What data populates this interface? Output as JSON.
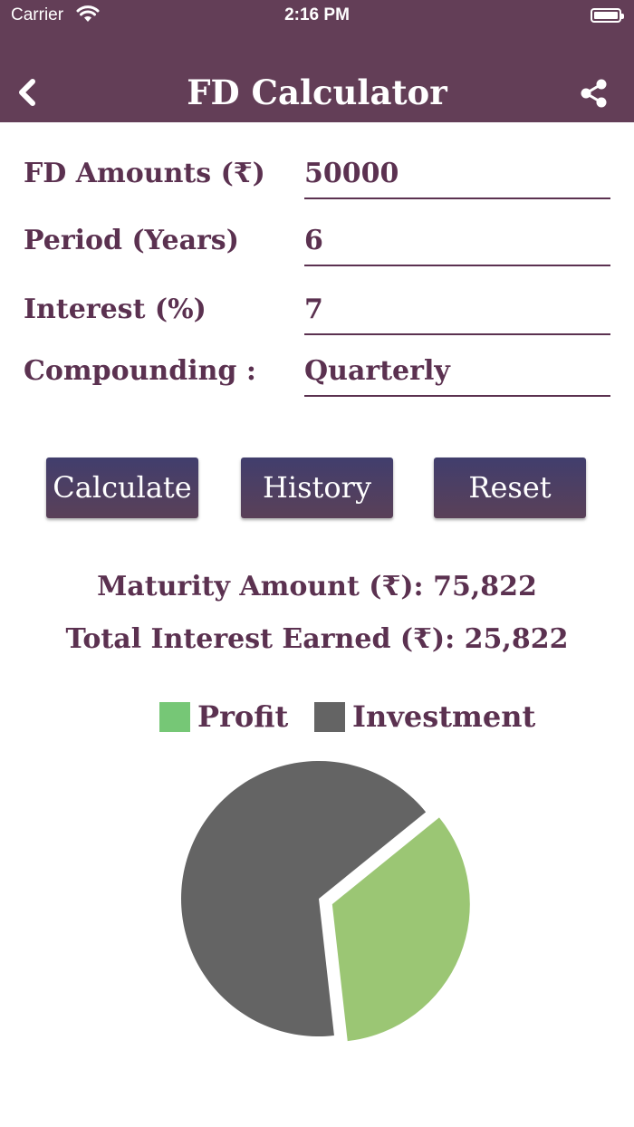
{
  "status_bar": {
    "carrier": "Carrier",
    "time": "2:16 PM"
  },
  "nav": {
    "title": "FD Calculator",
    "back_icon": "chevron-left-icon",
    "share_icon": "share-icon"
  },
  "form": {
    "fields": [
      {
        "label": "FD Amounts (₹)",
        "value": "50000"
      },
      {
        "label": "Period (Years)",
        "value": "6"
      },
      {
        "label": "Interest (%)",
        "value": "7"
      },
      {
        "label": "Compounding :",
        "value": "Quarterly"
      }
    ]
  },
  "buttons": {
    "calculate": "Calculate",
    "history": "History",
    "reset": "Reset"
  },
  "results": {
    "maturity": "Maturity Amount (₹): 75,822",
    "interest": "Total Interest Earned (₹): 25,822"
  },
  "colors": {
    "header": "#633e57",
    "text": "#5b3150",
    "profit_legend": "#76c776",
    "profit_slice": "#9bc674",
    "investment": "#646464"
  },
  "chart_data": {
    "type": "pie",
    "series": [
      {
        "name": "Profit",
        "value": 25822
      },
      {
        "name": "Investment",
        "value": 50000
      }
    ],
    "legend_position": "top"
  }
}
